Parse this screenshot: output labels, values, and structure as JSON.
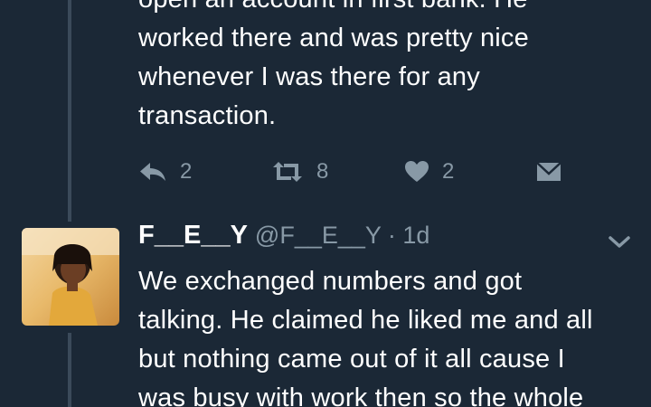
{
  "tweet_previous": {
    "text_lines": [
      "open an account in first bank. He",
      "worked there and was pretty nice",
      "whenever I was there for any",
      "transaction."
    ],
    "actions": {
      "reply": {
        "icon": "reply-icon",
        "count": "2"
      },
      "retweet": {
        "icon": "retweet-icon",
        "count": "8"
      },
      "like": {
        "icon": "heart-icon",
        "count": "2"
      },
      "message": {
        "icon": "envelope-icon"
      }
    }
  },
  "tweet_current": {
    "display_name": "F__E__Y",
    "meta": "@F__E__Y · 1d",
    "text_lines": [
      "We exchanged numbers and got",
      "talking. He claimed he liked me and all",
      "but nothing came out of it all cause I",
      "was busy with work then so the whole"
    ],
    "menu_icon": "chevron-down-icon"
  },
  "colors": {
    "background": "#1b2836",
    "text": "#ffffff",
    "muted": "#8899a6",
    "thread_line": "#3b4a5a"
  }
}
